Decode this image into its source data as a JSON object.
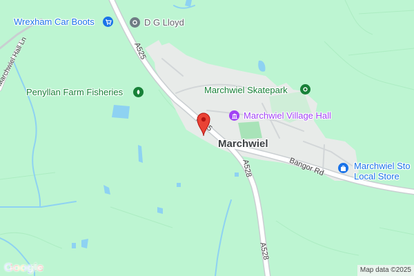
{
  "map": {
    "place_label": "Marchwiel",
    "road_labels": {
      "a525_top": "A525",
      "a525_pin": "A525",
      "a528_mid": "A528",
      "a528_low": "A528",
      "bangor_rd": "Bangor Rd",
      "marchwiel_hall_ln": "Marchwiel Hall Ln"
    },
    "pois": [
      {
        "key": "wrexham-car-boots",
        "label": "Wrexham Car Boots",
        "icon": "shopping-cart-icon",
        "color": "#1a73e8"
      },
      {
        "key": "dg-lloyd",
        "label": "D G Lloyd",
        "icon": "place-dot-icon",
        "color": "#6f7b84"
      },
      {
        "key": "penyllan-farm-fisheries",
        "label": "Penyllan Farm Fisheries",
        "icon": "park-leaf-icon",
        "color": "#188038"
      },
      {
        "key": "marchwiel-skatepark",
        "label": "Marchwiel Skatepark",
        "icon": "park-dot-icon",
        "color": "#188038"
      },
      {
        "key": "marchwiel-village-hall",
        "label": "Marchwiel Village Hall",
        "icon": "town-hall-icon",
        "color": "#a142f4"
      },
      {
        "key": "marchwiel-store",
        "label_lines": [
          "Marchwiel Sto",
          "Local Store"
        ],
        "icon": "shopping-bag-icon",
        "color": "#1a73e8"
      }
    ],
    "marker": {
      "icon": "map-pin-icon",
      "color": "#ea4335"
    },
    "colors": {
      "land": "#bdf5d2",
      "built": "#e8ebe9",
      "water": "#8ed2f2",
      "road": "#c9ced1"
    },
    "footer": {
      "logo": "Google",
      "attribution": "Map data ©2025"
    }
  }
}
